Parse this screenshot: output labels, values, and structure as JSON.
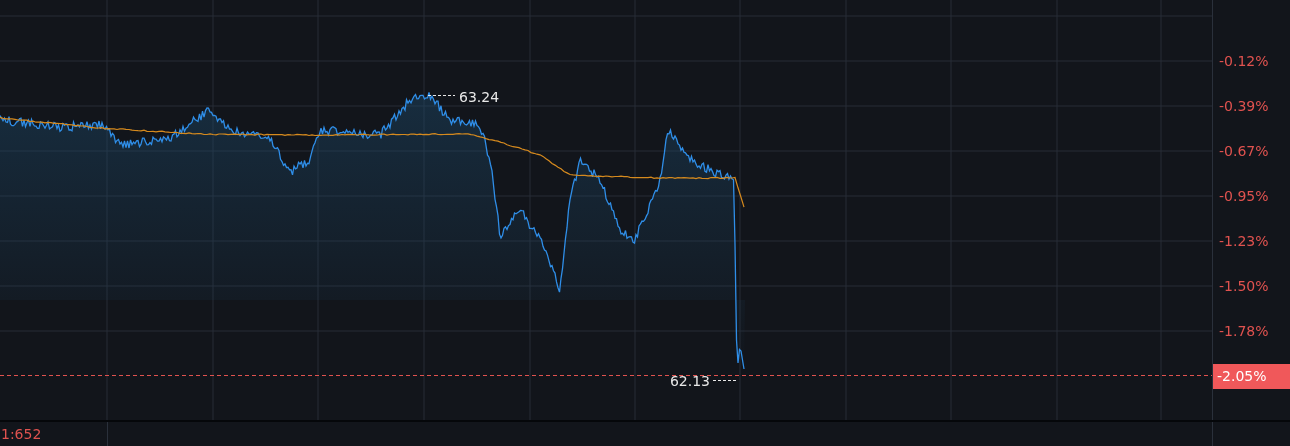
{
  "chart": {
    "high_label": "63.24",
    "low_label": "62.13"
  },
  "price_axis": {
    "labels": [
      "-0.12%",
      "-0.39%",
      "-0.67%",
      "-0.95%",
      "-1.23%",
      "-1.50%",
      "-1.78%"
    ],
    "current": "-2.05%"
  },
  "footer": {
    "indicator": "1:652"
  }
}
